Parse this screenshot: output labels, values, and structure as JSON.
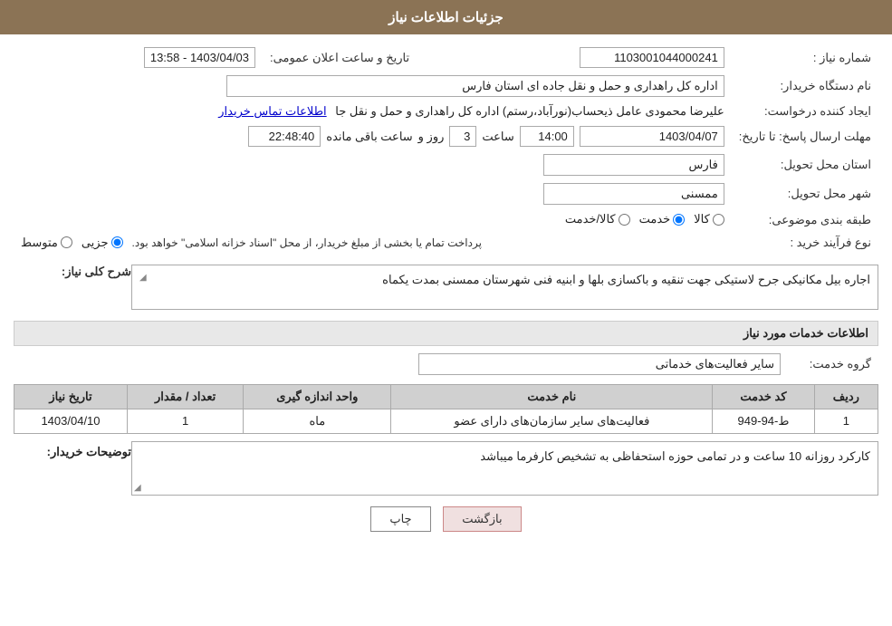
{
  "header": {
    "title": "جزئیات اطلاعات نیاز"
  },
  "fields": {
    "need_number_label": "شماره نیاز :",
    "need_number_value": "1103001044000241",
    "buyer_org_label": "نام دستگاه خریدار:",
    "buyer_org_value": "اداره کل راهداری و حمل و نقل جاده ای استان فارس",
    "creator_label": "ایجاد کننده درخواست:",
    "creator_value": "علیرضا محمودی عامل ذیحساب(نورآباد،رستم) اداره کل راهداری و حمل و نقل جا",
    "creator_link": "اطلاعات تماس خریدار",
    "deadline_label": "مهلت ارسال پاسخ: تا تاریخ:",
    "deadline_date": "1403/04/07",
    "deadline_time_label": "ساعت",
    "deadline_time": "14:00",
    "deadline_day_label": "روز و",
    "deadline_days": "3",
    "deadline_remaining_label": "ساعت باقی مانده",
    "deadline_remaining": "22:48:40",
    "province_label": "استان محل تحویل:",
    "province_value": "فارس",
    "city_label": "شهر محل تحویل:",
    "city_value": "ممسنی",
    "announce_date_label": "تاریخ و ساعت اعلان عمومی:",
    "announce_date_value": "1403/04/03 - 13:58",
    "category_label": "طبقه بندی موضوعی:",
    "category_options": [
      "کالا",
      "خدمت",
      "کالا/خدمت"
    ],
    "category_selected": "خدمت",
    "process_label": "نوع فرآیند خرید :",
    "process_options": [
      "جزیی",
      "متوسط"
    ],
    "process_note": "پرداخت تمام یا بخشی از مبلغ خریدار، از محل \"اسناد خزانه اسلامی\" خواهد بود.",
    "description_label": "شرح کلی نیاز:",
    "description_value": "اجاره بیل مکانیکی جرح لاستیکی جهت تنقیه و باکسازی بلها و ابنیه فنی شهرستان ممسنی بمدت یکماه",
    "services_label": "اطلاعات خدمات مورد نیاز",
    "service_group_label": "گروه خدمت:",
    "service_group_value": "سایر فعالیت‌های خدماتی",
    "table": {
      "columns": [
        "ردیف",
        "کد خدمت",
        "نام خدمت",
        "واحد اندازه گیری",
        "تعداد / مقدار",
        "تاریخ نیاز"
      ],
      "rows": [
        {
          "row_num": "1",
          "service_code": "ط-94-949",
          "service_name": "فعالیت‌های سایر سازمان‌های دارای عضو",
          "unit": "ماه",
          "quantity": "1",
          "date": "1403/04/10"
        }
      ]
    },
    "buyer_notes_label": "توضیحات خریدار:",
    "buyer_notes_value": "کارکرد روزانه 10 ساعت و در تمامی حوزه استحفاظی به تشخیص کارفرما میباشد"
  },
  "buttons": {
    "print_label": "چاپ",
    "back_label": "بازگشت"
  }
}
